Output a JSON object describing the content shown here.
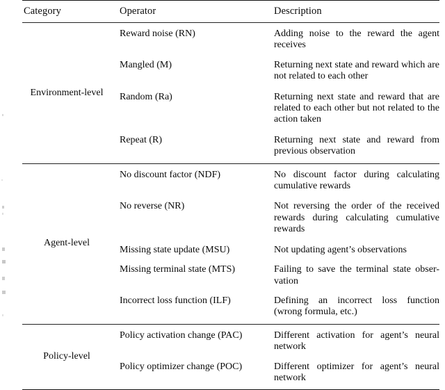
{
  "table": {
    "columns": [
      "Category",
      "Operator",
      "Description"
    ],
    "sections": [
      {
        "category": "Environment-level",
        "rows": [
          {
            "operator": "Reward noise (RN)",
            "description": "Adding noise to the reward the agent receives"
          },
          {
            "operator": "Mangled (M)",
            "description": "Returning next state and reward which are not related to each other"
          },
          {
            "operator": "Random (Ra)",
            "description": "Returning next state and reward that are related to each other but not related to the action taken"
          },
          {
            "operator": "Repeat (R)",
            "description": "Returning next state and reward from previous observation"
          }
        ]
      },
      {
        "category": "Agent-level",
        "rows": [
          {
            "operator": "No discount factor (NDF)",
            "description": "No discount factor during calculating cumulative rewards"
          },
          {
            "operator": "No reverse (NR)",
            "description": "Not reversing the order of the received rewards during calculating cumulative rewards"
          },
          {
            "operator": "Missing state update (MSU)",
            "description": "Not updating agent’s observations"
          },
          {
            "operator": "Missing terminal state (MTS)",
            "description": "Failing to save the terminal state obser-vation"
          },
          {
            "operator": "Incorrect loss function (ILF)",
            "description": "Defining an incorrect loss function (wrong formula, etc.)"
          }
        ]
      },
      {
        "category": "Policy-level",
        "rows": [
          {
            "operator": "Policy activation change (PAC)",
            "description": "Different activation for agent’s neural network"
          },
          {
            "operator": "Policy optimizer change (POC)",
            "description": "Different optimizer for agent’s neural network"
          }
        ]
      }
    ]
  },
  "style": {
    "rule_color": "#111111",
    "text_color": "#0a0a0a",
    "background": "#ffffff"
  }
}
